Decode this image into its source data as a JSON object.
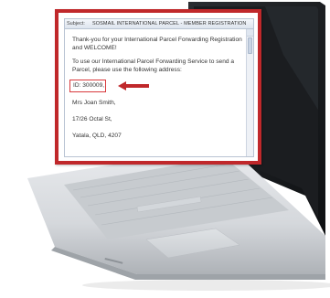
{
  "email": {
    "subject_label": "Subject:",
    "subject": "SOSMAIL INTERNATIONAL PARCEL - MEMBER REGISTRATION",
    "greeting": "Thank-you for your International Parcel Forwarding Registration and WELCOME!",
    "instructions": "To use our International Parcel Forwarding Service to send a Parcel, please use the following address:",
    "member_id": "ID: 300009,",
    "address_lines": [
      "Mrs Joan Smith,",
      "17/26 Octal St,",
      "Yatala, QLD, 4207"
    ]
  },
  "colors": {
    "highlight": "#c0282b",
    "laptop_silver": "#d9dcdf",
    "screen_bezel": "#141619"
  },
  "icons": {
    "arrow": "arrow-left-icon"
  }
}
